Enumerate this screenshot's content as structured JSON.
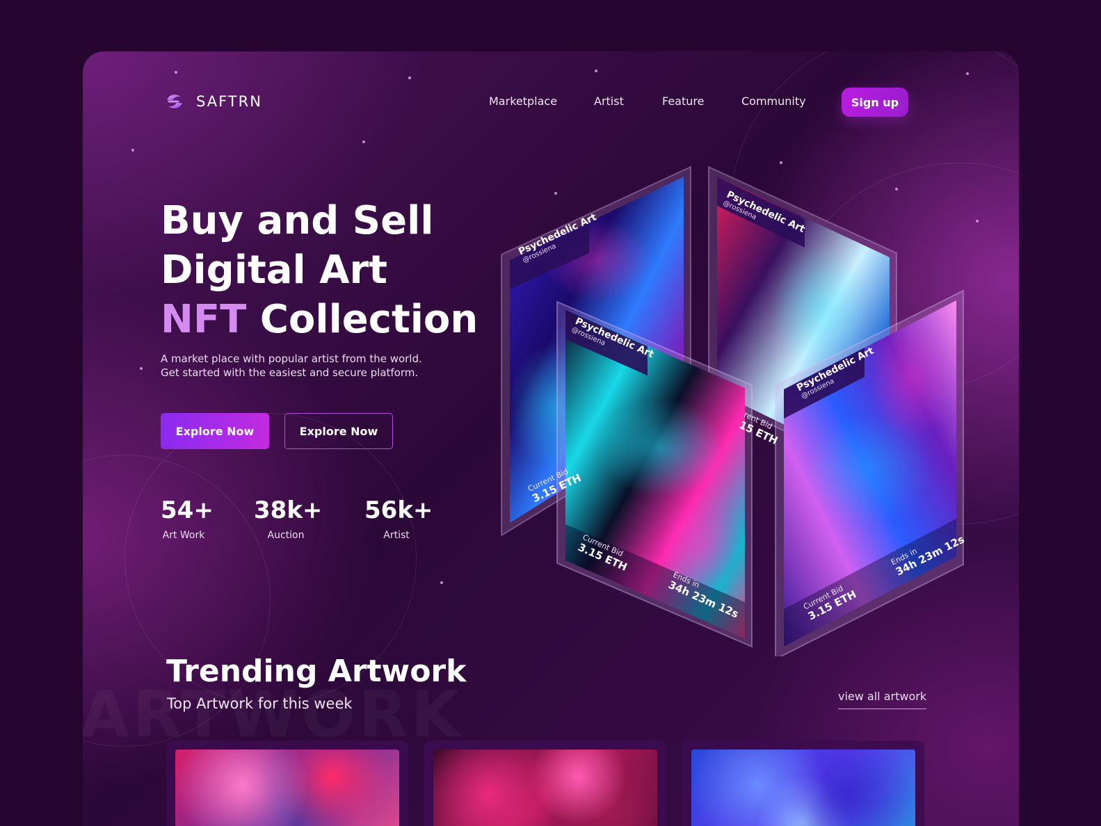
{
  "brand": {
    "name": "SAFTRN",
    "icon": "s-logo-icon"
  },
  "nav": {
    "items": [
      "Marketplace",
      "Artist",
      "Feature",
      "Community"
    ],
    "signup": "Sign up"
  },
  "hero": {
    "title_line1": "Buy and Sell",
    "title_line2": "Digital Art",
    "title_accent": "NFT",
    "title_rest": "Collection",
    "subtitle_line1": "A market place with popular artist from the world.",
    "subtitle_line2": "Get started with the easiest and secure platform.",
    "btn_primary": "Explore Now",
    "btn_secondary": "Explore Now"
  },
  "stats": [
    {
      "value": "54+",
      "label": "Art Work"
    },
    {
      "value": "38k+",
      "label": "Auction"
    },
    {
      "value": "56k+",
      "label": "Artist"
    }
  ],
  "cards": [
    {
      "title": "Psychedelic Art",
      "handle": "@rossiena",
      "bid_label": "Current Bid",
      "bid": "3.15 ETH"
    },
    {
      "title": "Psychedelic Art",
      "handle": "@rossiena",
      "bid_label": "rent Bid",
      "bid": "15 ETH"
    },
    {
      "title": "Psychedelic Art",
      "handle": "@rossiena",
      "bid_label": "Current Bid",
      "bid": "3.15 ETH",
      "ends_label": "Ends in",
      "ends": "34h 23m 12s"
    },
    {
      "title": "Psychedelic Art",
      "handle": "@rossiena",
      "bid_label": "Current Bid",
      "bid": "3.15 ETH",
      "ends_label": "Ends in",
      "ends": "34h 23m 12s"
    }
  ],
  "trending": {
    "title": "Trending Artwork",
    "subtitle": "Top Artwork for this week",
    "bg_word": "ARTWORK",
    "view_all": "view all artwork"
  },
  "colors": {
    "background": "#260530",
    "accent": "#d48bf0",
    "button": "#b81ce0"
  }
}
